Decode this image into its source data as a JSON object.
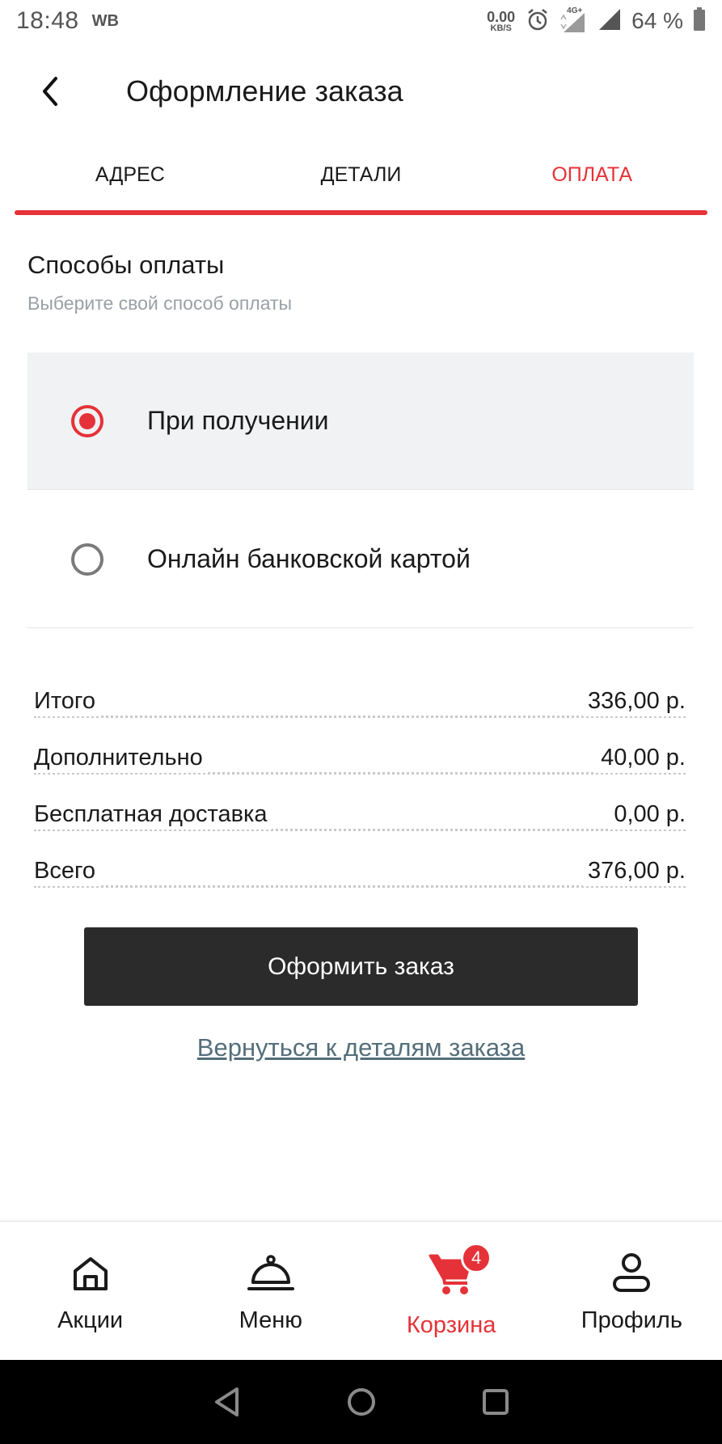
{
  "status_bar": {
    "time": "18:48",
    "carrier": "WB",
    "net_speed_value": "0.00",
    "net_speed_unit": "KB/S",
    "network_type": "4G+",
    "battery": "64 %"
  },
  "header": {
    "title": "Оформление заказа"
  },
  "tabs": [
    {
      "label": "АДРЕС",
      "active": false
    },
    {
      "label": "ДЕТАЛИ",
      "active": false
    },
    {
      "label": "ОПЛАТА",
      "active": true
    }
  ],
  "payment": {
    "title": "Способы оплаты",
    "subtitle": "Выберите свой способ оплаты",
    "options": [
      {
        "label": "При получении",
        "selected": true
      },
      {
        "label": "Онлайн банковской картой",
        "selected": false
      }
    ]
  },
  "summary": [
    {
      "label": "Итого",
      "value": "336,00 р."
    },
    {
      "label": "Дополнительно",
      "value": "40,00 р."
    },
    {
      "label": "Бесплатная доставка",
      "value": "0,00 р."
    },
    {
      "label": "Всего",
      "value": "376,00 р."
    }
  ],
  "actions": {
    "checkout_label": "Оформить заказ",
    "back_link_label": "Вернуться к деталям заказа"
  },
  "bottom_nav": {
    "items": [
      {
        "label": "Акции",
        "icon": "home-icon",
        "active": false
      },
      {
        "label": "Меню",
        "icon": "cloche-icon",
        "active": false
      },
      {
        "label": "Корзина",
        "icon": "cart-icon",
        "active": true,
        "badge": "4"
      },
      {
        "label": "Профиль",
        "icon": "user-icon",
        "active": false
      }
    ]
  },
  "colors": {
    "accent": "#e53238",
    "button_dark": "#2b2b2b",
    "link": "#546e7a",
    "selected_bg": "#f1f2f4"
  }
}
